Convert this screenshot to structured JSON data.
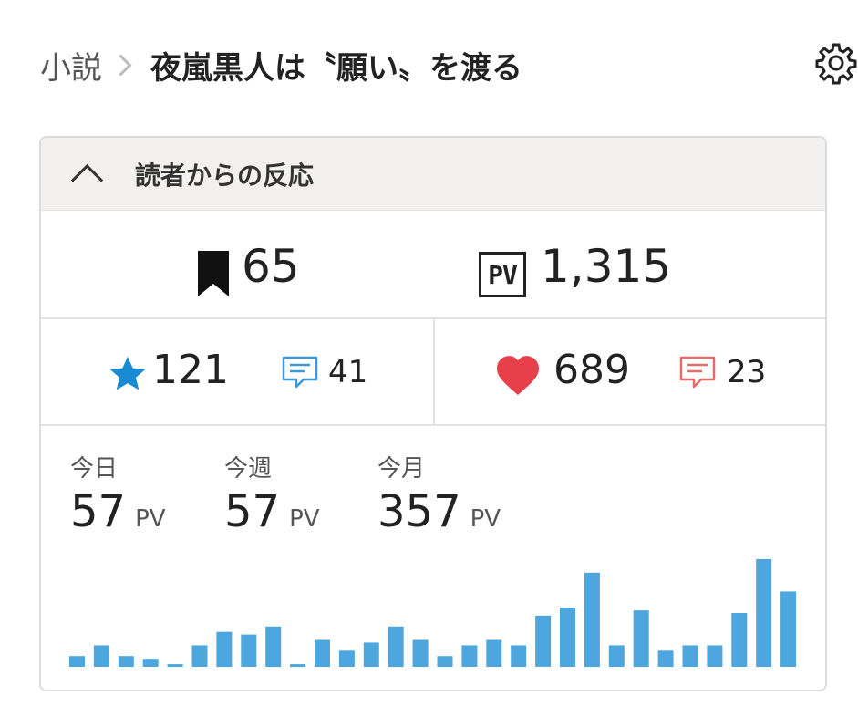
{
  "breadcrumb": {
    "parent": "小説",
    "title": "夜嵐黒人は〝願い〟を渡る"
  },
  "icons": {
    "settings": "gear-icon",
    "bookmark": "bookmark-icon",
    "pv": "pv-icon",
    "star": "star-icon",
    "heart": "heart-icon",
    "comment": "comment-icon"
  },
  "colors": {
    "star": "#1a8bd2",
    "heart": "#e8404a",
    "comment_blue": "#3f98d6",
    "comment_red": "#e36d6d",
    "bar": "#4ea6de"
  },
  "panel": {
    "title": "読者からの反応",
    "bookmarks": "65",
    "pv_label": "PV",
    "pv_total": "1,315",
    "stars": "121",
    "star_comments": "41",
    "hearts": "689",
    "heart_comments": "23"
  },
  "stats": [
    {
      "label": "今日",
      "value": "57",
      "unit": "PV"
    },
    {
      "label": "今週",
      "value": "57",
      "unit": "PV"
    },
    {
      "label": "今月",
      "value": "357",
      "unit": "PV"
    }
  ],
  "chart_data": {
    "type": "bar",
    "values": [
      4,
      8,
      4,
      3,
      1,
      8,
      13,
      12,
      15,
      1,
      10,
      6,
      9,
      15,
      10,
      4,
      8,
      10,
      8,
      19,
      22,
      35,
      8,
      21,
      6,
      8,
      8,
      20,
      40,
      28
    ]
  }
}
